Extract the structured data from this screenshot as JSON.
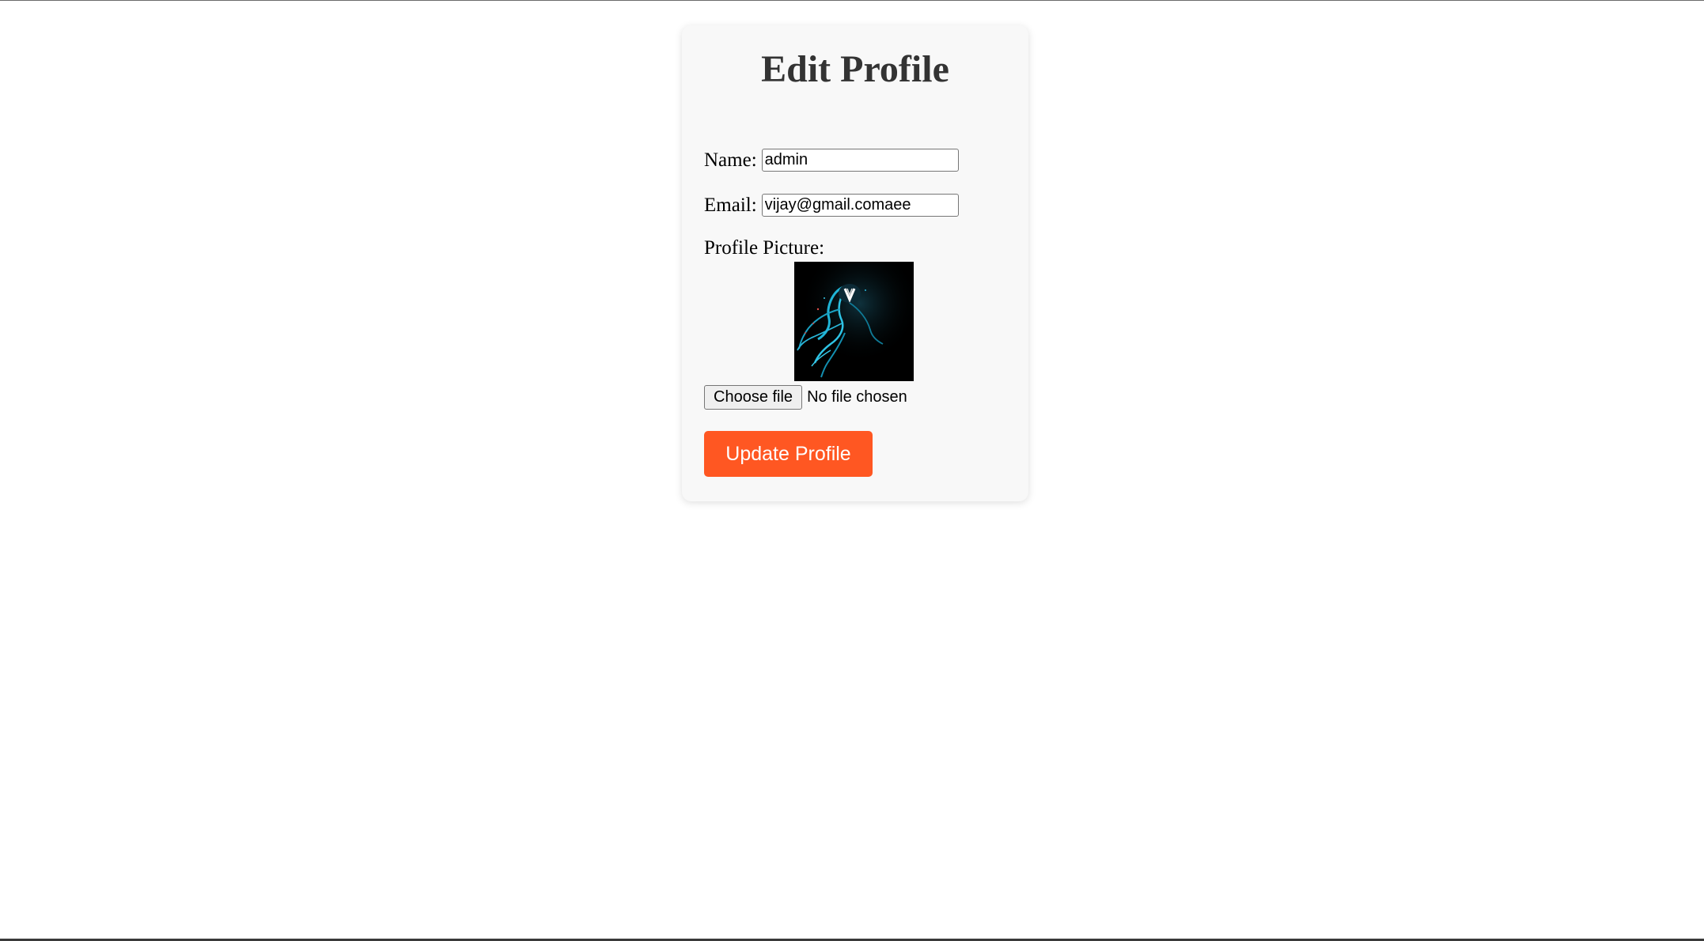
{
  "page": {
    "title": "Edit Profile"
  },
  "form": {
    "name_label": "Name:",
    "name_value": "admin",
    "email_label": "Email:",
    "email_value": "vijay@gmail.comaee",
    "picture_label": "Profile Picture:",
    "picture_icon": "profile-avatar-image",
    "choose_file_label": "Choose file",
    "file_status": "No file chosen",
    "submit_label": "Update Profile"
  },
  "colors": {
    "accent": "#ff5722",
    "card_background": "#f8f8f8",
    "title": "#333333"
  }
}
